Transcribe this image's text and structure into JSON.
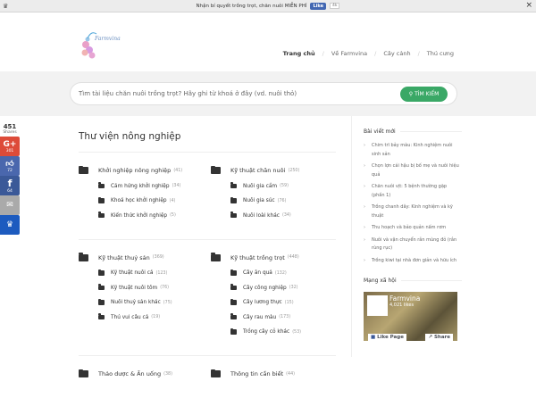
{
  "topbar": {
    "message": "Nhận bí quyết trồng trọt, chăn nuôi MIỄN PHÍ",
    "like_label": "Like",
    "like_count": "4k",
    "close": "×"
  },
  "header": {
    "logo_text": "Farmvina",
    "nav": [
      "Trang chủ",
      "Về Farmvina",
      "Cây cảnh",
      "Thú cưng"
    ]
  },
  "search": {
    "placeholder": "Tìm tài liệu chăn nuôi trồng trọt? Hãy ghi từ khoá ở đây (vd. nuôi thỏ)",
    "button": "TÌM KIẾM"
  },
  "main": {
    "title": "Thư viện nông nghiệp",
    "sections": [
      [
        {
          "name": "Khởi nghiệp nông nghiệp",
          "count": "(41)",
          "subs": [
            {
              "name": "Cảm hứng khởi nghiệp",
              "count": "(34)"
            },
            {
              "name": "Khoá học khởi nghiệp",
              "count": "(4)"
            },
            {
              "name": "Kiến thức khởi nghiệp",
              "count": "(5)"
            }
          ]
        },
        {
          "name": "Kỹ thuật chăn nuôi",
          "count": "(250)",
          "subs": [
            {
              "name": "Nuôi gia cầm",
              "count": "(59)"
            },
            {
              "name": "Nuôi gia súc",
              "count": "(76)"
            },
            {
              "name": "Nuôi loài khác",
              "count": "(34)"
            }
          ]
        }
      ],
      [
        {
          "name": "Kỹ thuật thuỷ sản",
          "count": "(369)",
          "subs": [
            {
              "name": "Kỹ thuật nuôi cá",
              "count": "(123)"
            },
            {
              "name": "Kỹ thuật nuôi tôm",
              "count": "(76)"
            },
            {
              "name": "Nuôi thuỷ sản khác",
              "count": "(75)"
            },
            {
              "name": "Thú vui câu cá",
              "count": "(19)"
            }
          ]
        },
        {
          "name": "Kỹ thuật trồng trọt",
          "count": "(448)",
          "subs": [
            {
              "name": "Cây ăn quả",
              "count": "(132)"
            },
            {
              "name": "Cây công nghiệp",
              "count": "(32)"
            },
            {
              "name": "Cây lương thực",
              "count": "(15)"
            },
            {
              "name": "Cây rau màu",
              "count": "(173)"
            },
            {
              "name": "Trồng cây cỏ khác",
              "count": "(53)"
            }
          ]
        }
      ],
      [
        {
          "name": "Thảo dược & Ăn uống",
          "count": "(38)",
          "subs": []
        },
        {
          "name": "Thông tin cần biết",
          "count": "(44)",
          "subs": []
        }
      ]
    ]
  },
  "sidebar": {
    "recent_title": "Bài viết mới",
    "posts": [
      "Chim trĩ bảy màu: Kinh nghiệm nuôi sinh sản",
      "Chọn lợn cái hậu bị bố mẹ và nuôi hiệu quả",
      "Chăn nuôi vịt: 5 bệnh thường gặp (phần 1)",
      "Trồng chanh dây: Kinh nghiệm và kỹ thuật",
      "Thu hoạch và bảo quản nấm rơm",
      "Nuôi và vận chuyển rắn mùng đỏ (rắn rùng rục)",
      "Trồng kiwi tại nhà đơn giản và hữu ích"
    ],
    "social_title": "Mạng xã hội",
    "fb": {
      "name": "Farmvina",
      "likes": "4,021 likes",
      "like_page": "Like Page",
      "share": "Share"
    }
  },
  "share_bar": {
    "total": "451",
    "label": "Shares",
    "gplus": "301",
    "like": "72",
    "facebook": "64"
  },
  "colors": {
    "search_button": "#3aa866",
    "gplus": "#dd4b39",
    "like": "#4a67ad",
    "facebook": "#3b5998",
    "email": "#aaaaaa",
    "crown": "#1d5bbf"
  }
}
